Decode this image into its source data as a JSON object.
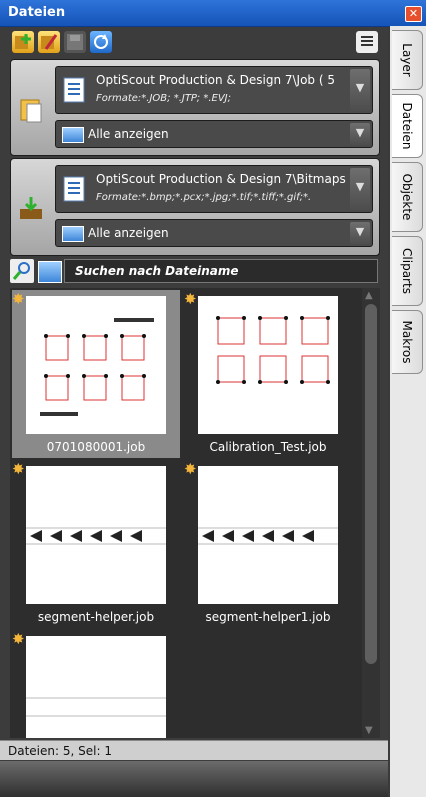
{
  "window": {
    "title": "Dateien"
  },
  "toolbar": {
    "icons": [
      "add-folder-icon",
      "edit-folder-icon",
      "save-icon",
      "refresh-icon",
      "list-view-icon"
    ]
  },
  "groups": [
    {
      "path": "OptiScout Production & Design 7\\Job ( 5",
      "formats": "Formate:*.JOB; *.JTP; *.EVJ;",
      "filter": "Alle anzeigen"
    },
    {
      "path": "OptiScout Production & Design 7\\Bitmaps",
      "formats": "Formate:*.bmp;*.pcx;*.jpg;*.tif;*.tiff;*.gif;*.",
      "filter": "Alle anzeigen"
    }
  ],
  "search": {
    "label": "Suchen nach Dateiname"
  },
  "files": [
    {
      "name": "0701080001.job",
      "selected": true
    },
    {
      "name": "Calibration_Test.job",
      "selected": false
    },
    {
      "name": "segment-helper.job",
      "selected": false
    },
    {
      "name": "segment-helper1.job",
      "selected": false
    },
    {
      "name": "",
      "selected": false
    }
  ],
  "status": "Dateien: 5, Sel: 1",
  "side_tabs": [
    "Layer",
    "Dateien",
    "Objekte",
    "Cliparts",
    "Makros"
  ],
  "colors": {
    "title": "#1f5fc8",
    "panel": "#3c3c3c",
    "accent_star": "#f4b53b"
  }
}
